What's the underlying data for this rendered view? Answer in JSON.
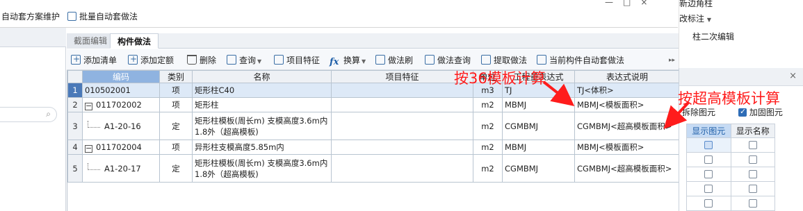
{
  "topbar": {
    "item1": "自动套方案维护",
    "item2": "批量自动套做法",
    "win_controls": [
      "—",
      "□",
      "×"
    ]
  },
  "right_top": {
    "item1": "新边角柱",
    "item2": "改标注",
    "item3": "柱二次编辑"
  },
  "tabs": [
    "截面编辑",
    "构件做法"
  ],
  "toolbar": {
    "add_list": "添加清单",
    "add_quota": "添加定额",
    "delete": "删除",
    "query": "查询",
    "item_feature": "项目特征",
    "convert": "换算",
    "method_brush": "做法刷",
    "method_query": "做法查询",
    "extract": "提取做法",
    "auto_apply": "当前构件自动套做法",
    "more": "▸▸"
  },
  "grid": {
    "columns": [
      "",
      "编码",
      "类别",
      "名称",
      "项目特征",
      "单位",
      "工程量表达式",
      "表达式说明"
    ],
    "rows": [
      {
        "n": "1",
        "code": "010502001",
        "type": "项",
        "name": "矩形柱C40",
        "feature": "",
        "unit": "m3",
        "expr": "TJ",
        "desc": "TJ<体积>"
      },
      {
        "n": "2",
        "code": "011702002",
        "type": "项",
        "name": "矩形柱",
        "feature": "",
        "unit": "m2",
        "expr": "MBMJ",
        "desc": "MBMJ<模板面积>"
      },
      {
        "n": "3",
        "code": "A1-20-16",
        "type": "定",
        "name": "矩形柱模板(周长m) 支模高度3.6m内 1.8外（超高模板)",
        "feature": "",
        "unit": "m2",
        "expr": "CGMBMJ",
        "desc": "CGMBMJ<超高模板面积>"
      },
      {
        "n": "4",
        "code": "011702004",
        "type": "项",
        "name": "异形柱支模高度5.85m内",
        "feature": "",
        "unit": "m2",
        "expr": "MBMJ",
        "desc": "MBMJ<模板面积>"
      },
      {
        "n": "5",
        "code": "A1-20-17",
        "type": "定",
        "name": "矩形柱模板(周长m) 支模高度3.6m内 1.8外（超高模板)",
        "feature": "",
        "unit": "m2",
        "expr": "CGMBMJ",
        "desc": "CGMBMJ<超高模板面积>"
      }
    ]
  },
  "right_panel": {
    "close": "×",
    "check1": "拆除图元",
    "check2": "加固图元",
    "col1": "显示图元",
    "col2": "显示名称"
  },
  "annotations": {
    "note1": "按36模板计算",
    "note2": "按超高模板计算",
    "color": "#ff1c1c"
  }
}
